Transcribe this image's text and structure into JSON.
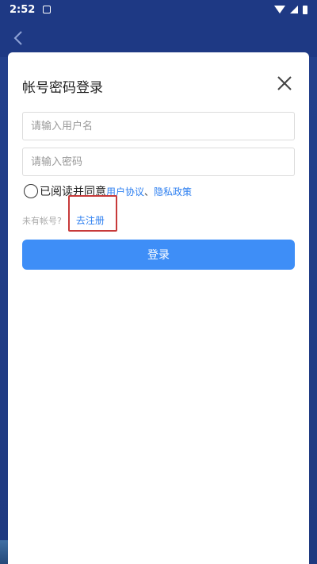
{
  "status_bar": {
    "time": "2:52",
    "icons": [
      "notification-icon",
      "wifi-icon",
      "signal-icon",
      "battery-icon"
    ]
  },
  "header": {
    "back_icon": "chevron-left-icon"
  },
  "login_sheet": {
    "title": "帐号密码登录",
    "close_icon": "close-icon",
    "username_placeholder": "请输入用户名",
    "password_placeholder": "请输入密码",
    "agreement": {
      "prefix": "已阅读并同意",
      "user_agreement": "用户协议",
      "separator": "、",
      "privacy_policy": "隐私政策",
      "checked": false
    },
    "register": {
      "prompt": "未有帐号?",
      "link": "去注册"
    },
    "login_button": "登录"
  },
  "colors": {
    "header_bg": "#1e3984",
    "accent": "#3e8ef7",
    "link": "#2d7ff0",
    "highlight": "#c73a3a"
  }
}
